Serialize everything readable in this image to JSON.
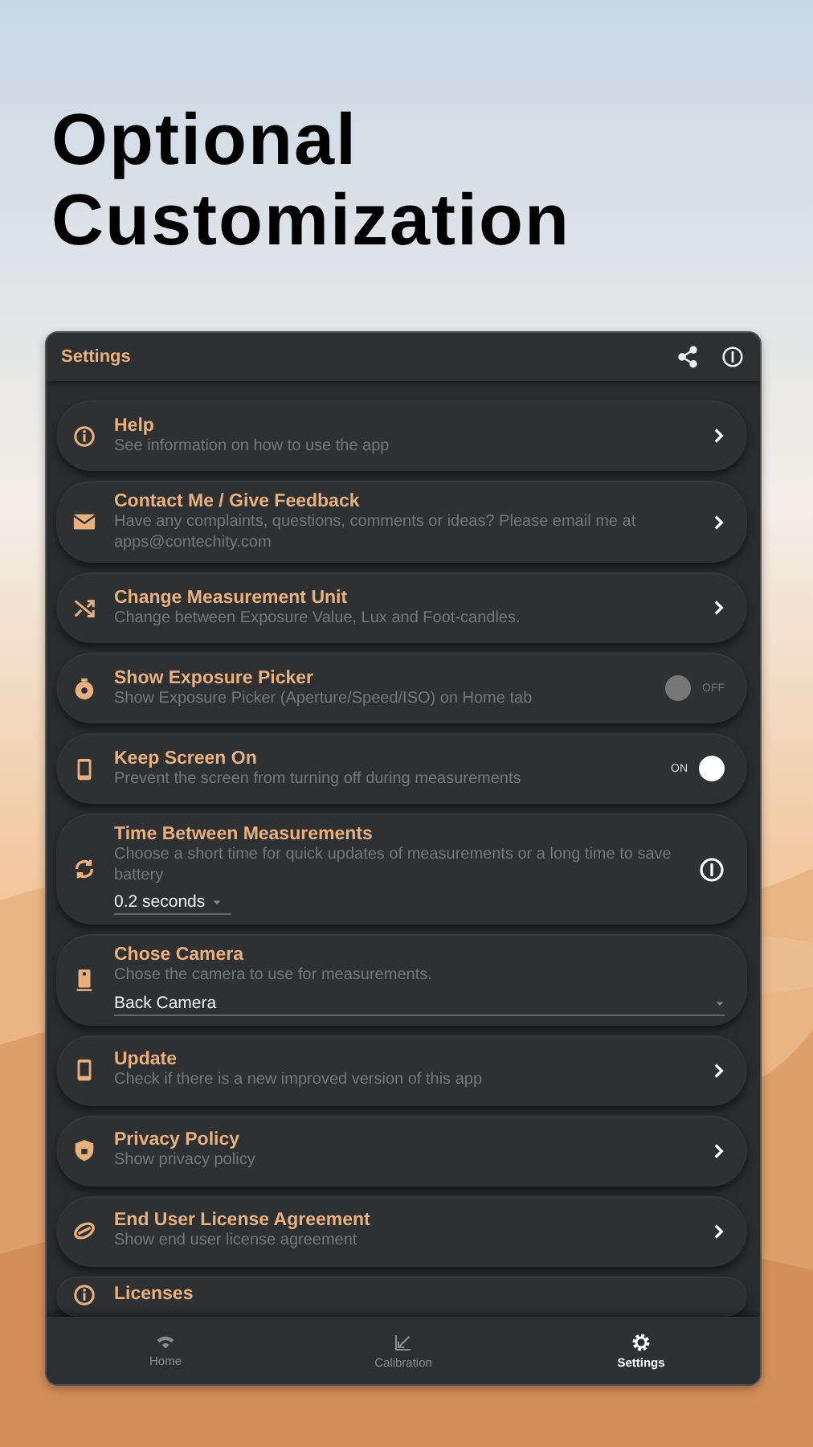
{
  "headline": [
    "Optional",
    "Customization"
  ],
  "app": {
    "title": "Settings"
  },
  "rows": [
    {
      "kind": "link",
      "title": "Help",
      "subtitle": "See information on how to use the app"
    },
    {
      "kind": "link",
      "title": "Contact Me / Give Feedback",
      "subtitle": "Have any complaints, questions, comments or ideas? Please email me at apps@contechity.com"
    },
    {
      "kind": "link",
      "title": "Change Measurement Unit",
      "subtitle": "Change between Exposure Value, Lux and Foot-candles."
    },
    {
      "kind": "toggle",
      "title": "Show Exposure Picker",
      "subtitle": "Show Exposure Picker (Aperture/Speed/ISO) on Home tab",
      "on": false,
      "switch_label": "OFF"
    },
    {
      "kind": "toggle",
      "title": "Keep Screen On",
      "subtitle": "Prevent the screen from turning off during measurements",
      "on": true,
      "switch_label": "ON"
    },
    {
      "kind": "select_info",
      "title": "Time Between Measurements",
      "subtitle": "Choose a short time for quick updates of measurements or a long time to save battery",
      "value": "0.2 seconds"
    },
    {
      "kind": "select",
      "title": "Chose Camera",
      "subtitle": "Chose the camera to use for measurements.",
      "value": "Back Camera"
    },
    {
      "kind": "link",
      "title": "Update",
      "subtitle": "Check if there is a new improved version of this app"
    },
    {
      "kind": "link",
      "title": "Privacy Policy",
      "subtitle": "Show privacy policy"
    },
    {
      "kind": "link",
      "title": "End User License Agreement",
      "subtitle": "Show end user license agreement"
    },
    {
      "kind": "cut",
      "title": "Licenses"
    }
  ],
  "nav": [
    {
      "label": "Home",
      "selected": false
    },
    {
      "label": "Calibration",
      "selected": false
    },
    {
      "label": "Settings",
      "selected": true
    }
  ]
}
